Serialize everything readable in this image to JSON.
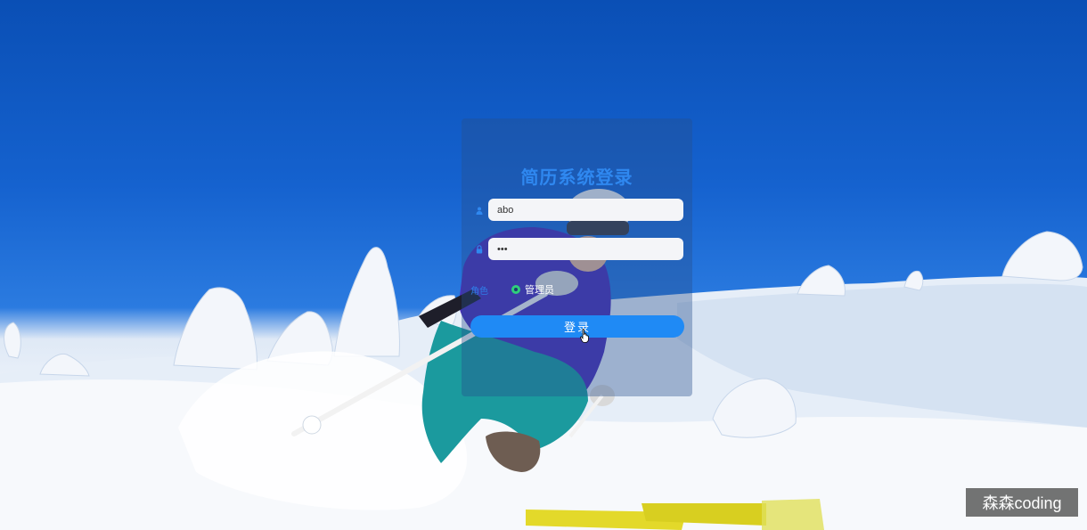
{
  "login": {
    "title": "简历系统登录",
    "username": {
      "value": "abo",
      "icon": "user-icon"
    },
    "password": {
      "value": "•••",
      "icon": "lock-icon"
    },
    "role": {
      "label": "角色",
      "options": [
        {
          "label": "管理员",
          "selected": true
        }
      ]
    },
    "submit_label": "登录"
  },
  "watermark": {
    "text": "森森coding"
  },
  "colors": {
    "accent": "#1f8af5",
    "title": "#2f88f0",
    "radio": "#2fd07a"
  }
}
